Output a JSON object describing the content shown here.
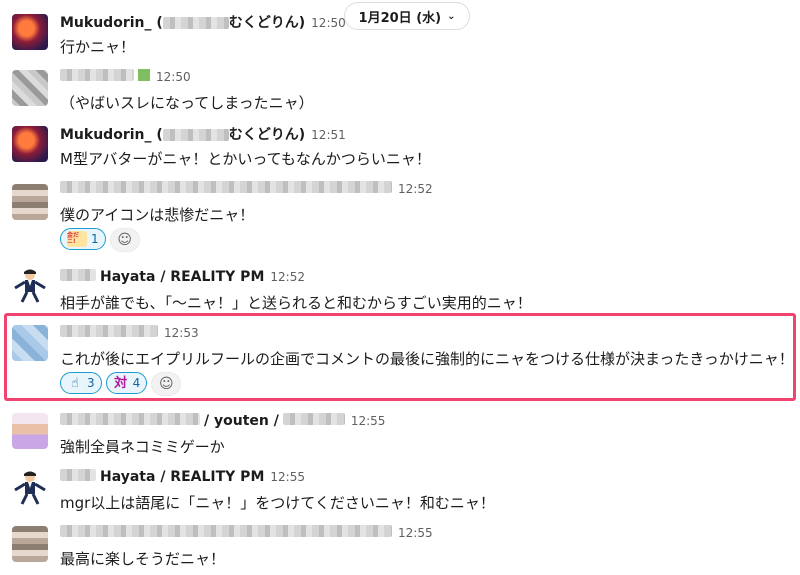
{
  "date_divider": {
    "label": "1月20日 (水)",
    "icon": "chevron-down-icon"
  },
  "messages": [
    {
      "name_prefix": "Mukudorin_ (",
      "name_suffix": "むくどりん)",
      "time": "12:50",
      "text": "行かニャ！"
    },
    {
      "time": "12:50",
      "text": "（やばいスレになってしまったニャ）"
    },
    {
      "name_prefix": "Mukudorin_ (",
      "name_suffix": "むくどりん)",
      "time": "12:51",
      "text": "M型アバターがニャ！とかいってもなんかつらいニャ！"
    },
    {
      "time": "12:52",
      "text": "僕のアイコンは悲惨だニャ！",
      "reactions": [
        {
          "emoji": "金だニ!",
          "count": "1"
        }
      ]
    },
    {
      "name": "Hayata / REALITY PM",
      "time": "12:52",
      "text": "相手が誰でも、「〜ニャ！」と送られると和むからすごい実用的ニャ！"
    },
    {
      "time": "12:53",
      "text": "これが後にエイプリルフールの企画でコメントの最後に強制的にニャをつける仕様が決まったきっかけニャ！",
      "reactions": [
        {
          "emoji": "pointing-hand",
          "count": "3"
        },
        {
          "emoji": "対",
          "count": "4"
        }
      ]
    },
    {
      "name_suffix": "/ youten /",
      "time": "12:55",
      "text": "強制全員ネコミミゲーか"
    },
    {
      "name": "Hayata / REALITY PM",
      "time": "12:55",
      "text": "mgr以上は語尾に「ニャ！」をつけてくださいニャ！和むニャ！"
    },
    {
      "time": "12:55",
      "text": "最高に楽しそうだニャ！"
    }
  ],
  "colors": {
    "highlight": "#f0436f",
    "reaction_border": "#1d9bd1",
    "reaction_bg": "#e8f5fa"
  }
}
